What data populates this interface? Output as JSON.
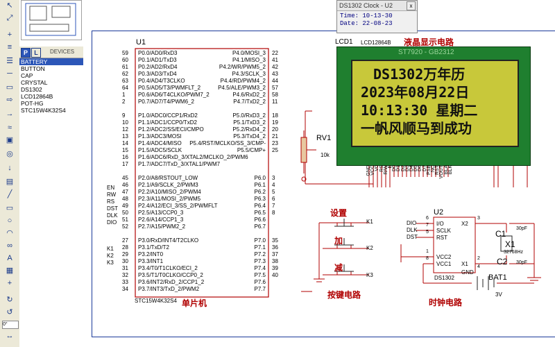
{
  "devices": {
    "pick_label": "P",
    "lib_label": "L",
    "title": "DEVICES",
    "items": [
      "BATTERY",
      "BUTTON",
      "CAP",
      "CRYSTAL",
      "DS1302",
      "LCD12864B",
      "POT-HG",
      "STC15W4K32S4"
    ],
    "selected": "BATTERY"
  },
  "popup": {
    "title": "DS1302 Clock - U2",
    "close": "x",
    "time": "Time: 10-13-30",
    "date": "Date: 22-08-23"
  },
  "lcd": {
    "ref": "LCD1",
    "part": "LCD12864B",
    "caption": "液晶显示电路",
    "header": "ST7920 - GB2312",
    "lines": [
      "DS1302万年历",
      "2023年08月22日",
      "10:13:30  星期二",
      "一帆风顺马到成功"
    ],
    "pins": [
      "GND",
      "VCC",
      "V0",
      "RS",
      "R/W",
      "E",
      "D0",
      "D1",
      "D2",
      "D3",
      "D4",
      "D5",
      "D6",
      "D7",
      "PSB",
      "NC",
      "RST",
      "VOUT",
      "BLA",
      "BLK"
    ]
  },
  "mcu": {
    "ref": "U1",
    "part": "STC15W4K32S4",
    "caption": "单片机",
    "left_pins": [
      {
        "n": "59",
        "t": "P0.0/AD0/RxD3"
      },
      {
        "n": "60",
        "t": "P0.1/AD1/TxD3"
      },
      {
        "n": "61",
        "t": "P0.2/AD2/RxD4"
      },
      {
        "n": "62",
        "t": "P0.3/AD3/TxD4"
      },
      {
        "n": "63",
        "t": "P0.4/AD4/T3CLKO"
      },
      {
        "n": "64",
        "t": "P0.5/AD5/T3/PWMFLT_2"
      },
      {
        "n": "1",
        "t": "P0.6/AD6/T4CLKO/PWM7_2"
      },
      {
        "n": "2",
        "t": "P0.7/AD7/T4/PWM6_2"
      },
      {
        "n": "9",
        "t": "P1.0/ADC0/CCP1/RxD2"
      },
      {
        "n": "10",
        "t": "P1.1/ADC1/CCP0/TxD2"
      },
      {
        "n": "12",
        "t": "P1.2/ADC2/SS/ECI/CMPO"
      },
      {
        "n": "13",
        "t": "P1.3/ADC3/MOSI"
      },
      {
        "n": "14",
        "t": "P1.4/ADC4/MISO"
      },
      {
        "n": "15",
        "t": "P1.5/ADC5/SCLK"
      },
      {
        "n": "16",
        "t": "P1.6/ADC6/RxD_3/XTAL2/MCLKO_2/PWM6"
      },
      {
        "n": "17",
        "t": "P1.7/ADC7/TxD_3/XTAL1/PWM7"
      },
      {
        "n": "45",
        "t": "P2.0/A8/RSTOUT_LOW"
      },
      {
        "n": "46",
        "t": "P2.1/A9/SCLK_2/PWM3"
      },
      {
        "n": "47",
        "t": "P2.2/A10/MISO_2/PWM4"
      },
      {
        "n": "48",
        "t": "P2.3/A11/MOSI_2/PWM5"
      },
      {
        "n": "49",
        "t": "P2.4/A12/ECI_3/SS_2/PWMFLT"
      },
      {
        "n": "50",
        "t": "P2.5/A13/CCP0_3"
      },
      {
        "n": "51",
        "t": "P2.6/A14/CCP1_3"
      },
      {
        "n": "52",
        "t": "P2.7/A15/PWM2_2"
      },
      {
        "n": "27",
        "t": "P3.0/RxD/INT4/T2CLKO"
      },
      {
        "n": "28",
        "t": "P3.1/TxD/T2"
      },
      {
        "n": "29",
        "t": "P3.2/INT0"
      },
      {
        "n": "30",
        "t": "P3.3/INT1"
      },
      {
        "n": "31",
        "t": "P3.4/T0/T1CLKO/ECI_2"
      },
      {
        "n": "32",
        "t": "P3.5/T1/T0CLKO/CCP0_2"
      },
      {
        "n": "33",
        "t": "P3.6/INT2/RxD_2/CCP1_2"
      },
      {
        "n": "34",
        "t": "P3.7/INT3/TxD_2/PWM2"
      }
    ],
    "right_pins": [
      {
        "n": "22",
        "t": "P4.0/MOSI_3"
      },
      {
        "n": "41",
        "t": "P4.1/MISO_3"
      },
      {
        "n": "42",
        "t": "P4.2/WR/PWM5_2"
      },
      {
        "n": "43",
        "t": "P4.3/SCLK_3"
      },
      {
        "n": "44",
        "t": "P4.4/RD/PWM4_2"
      },
      {
        "n": "57",
        "t": "P4.5/ALE/PWM3_2"
      },
      {
        "n": "58",
        "t": "P4.6/RxD2_2"
      },
      {
        "n": "11",
        "t": "P4.7/TxD2_2"
      },
      {
        "n": "18",
        "t": "P5.0/RxD3_2"
      },
      {
        "n": "19",
        "t": "P5.1/TxD3_2"
      },
      {
        "n": "20",
        "t": "P5.2/RxD4_2"
      },
      {
        "n": "21",
        "t": "P5.3/TxD4_2"
      },
      {
        "n": "23",
        "t": "P5.4/RST/MCLKO/SS_3/CMP-"
      },
      {
        "n": "25",
        "t": "P5.5/CMP+"
      },
      {
        "n": "3",
        "t": "P6.0"
      },
      {
        "n": "4",
        "t": "P6.1"
      },
      {
        "n": "5",
        "t": "P6.2"
      },
      {
        "n": "6",
        "t": "P6.3"
      },
      {
        "n": "7",
        "t": "P6.4"
      },
      {
        "n": "8",
        "t": "P6.5"
      },
      {
        "n": "",
        "t": "P6.6"
      },
      {
        "n": "",
        "t": "P6.7"
      },
      {
        "n": "35",
        "t": "P7.0"
      },
      {
        "n": "36",
        "t": "P7.1"
      },
      {
        "n": "37",
        "t": "P7.2"
      },
      {
        "n": "38",
        "t": "P7.3"
      },
      {
        "n": "39",
        "t": "P7.4"
      },
      {
        "n": "40",
        "t": "P7.5"
      },
      {
        "n": "",
        "t": "P7.6"
      },
      {
        "n": "",
        "t": "P7.7"
      }
    ],
    "net_labels_p2": [
      "EN",
      "RW",
      "RS",
      "DST",
      "DLK",
      "DIO"
    ],
    "net_labels_p3": [
      "K1",
      "K2",
      "K3"
    ]
  },
  "pot": {
    "ref": "RV1",
    "value": "10k"
  },
  "buttons": {
    "caption": "按键电路",
    "items": [
      {
        "label": "设置",
        "net": "K1"
      },
      {
        "label": "加",
        "net": "K2"
      },
      {
        "label": "减",
        "net": "K3"
      }
    ]
  },
  "rtc": {
    "ref": "U2",
    "part": "DS1302",
    "caption": "时钟电路",
    "pins_left": [
      "I/O",
      "SCLK",
      "RST",
      "VCC2",
      "VCC1"
    ],
    "pins_left_num": [
      "6",
      "7",
      "5",
      "1",
      "8"
    ],
    "pins_right": [
      "X2",
      "X1",
      "GND"
    ],
    "pins_right_num": [
      "3",
      "2",
      "4"
    ],
    "nets": [
      "DIO",
      "DLK",
      "DST"
    ],
    "c1": {
      "ref": "C1",
      "value": "30pF"
    },
    "c2": {
      "ref": "C2",
      "value": "30pF"
    },
    "x1": {
      "ref": "X1",
      "value": "32768Hz"
    },
    "bat": {
      "ref": "BAT1",
      "value": "3V"
    }
  }
}
